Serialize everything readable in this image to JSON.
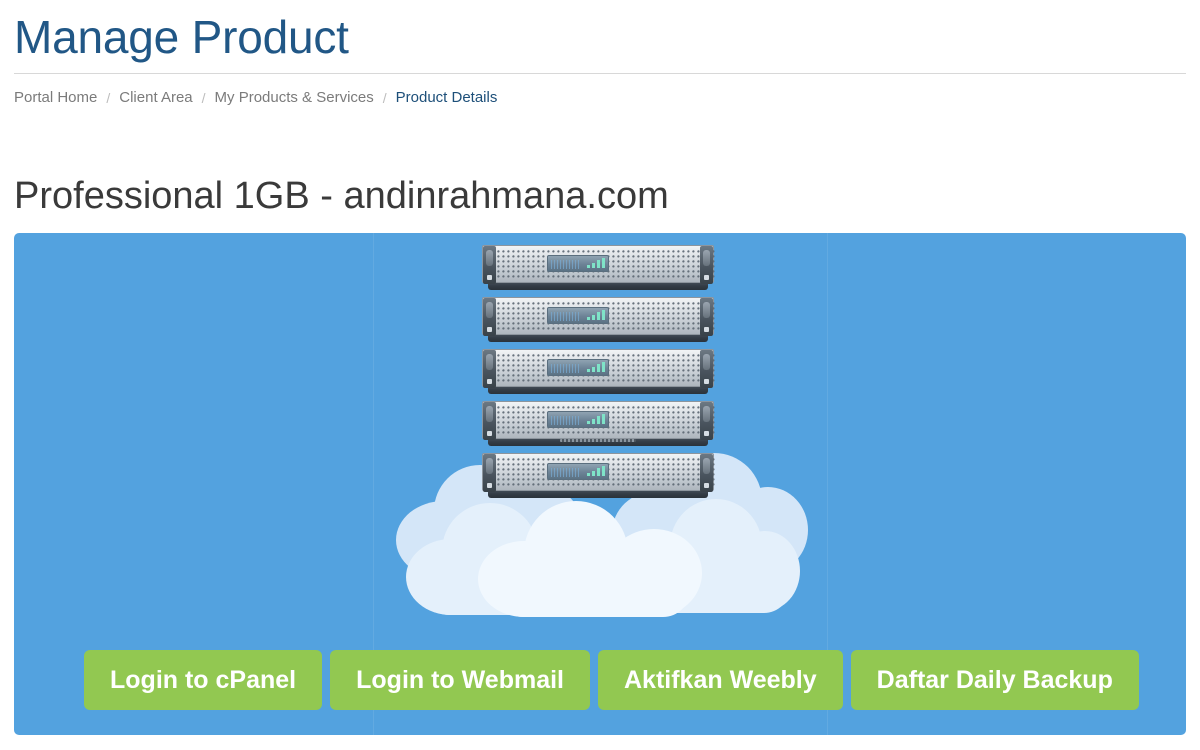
{
  "header": {
    "title": "Manage Product"
  },
  "breadcrumb": {
    "separator": "/",
    "items": [
      {
        "label": "Portal Home",
        "active": false
      },
      {
        "label": "Client Area",
        "active": false
      },
      {
        "label": "My Products & Services",
        "active": false
      },
      {
        "label": "Product Details",
        "active": true
      }
    ]
  },
  "product": {
    "heading": "Professional 1GB - andinrahmana.com"
  },
  "hero": {
    "background_color": "#53a2df",
    "artwork": {
      "name": "cloud-server-stack-illustration",
      "server_count": 5,
      "cloud_count": 3
    },
    "actions": [
      {
        "label": "Login to cPanel",
        "name": "login-to-cpanel-button"
      },
      {
        "label": "Login to Webmail",
        "name": "login-to-webmail-button"
      },
      {
        "label": "Aktifkan Weebly",
        "name": "aktifkan-weebly-button"
      },
      {
        "label": "Daftar Daily Backup",
        "name": "daftar-daily-backup-button"
      }
    ]
  },
  "colors": {
    "heading": "#215786",
    "breadcrumb_link": "#7b7b7b",
    "breadcrumb_active": "#1d4f79",
    "product_heading": "#3a3a3a",
    "panel_blue": "#53a2df",
    "button_green": "#92c851",
    "button_text": "#ffffff"
  }
}
